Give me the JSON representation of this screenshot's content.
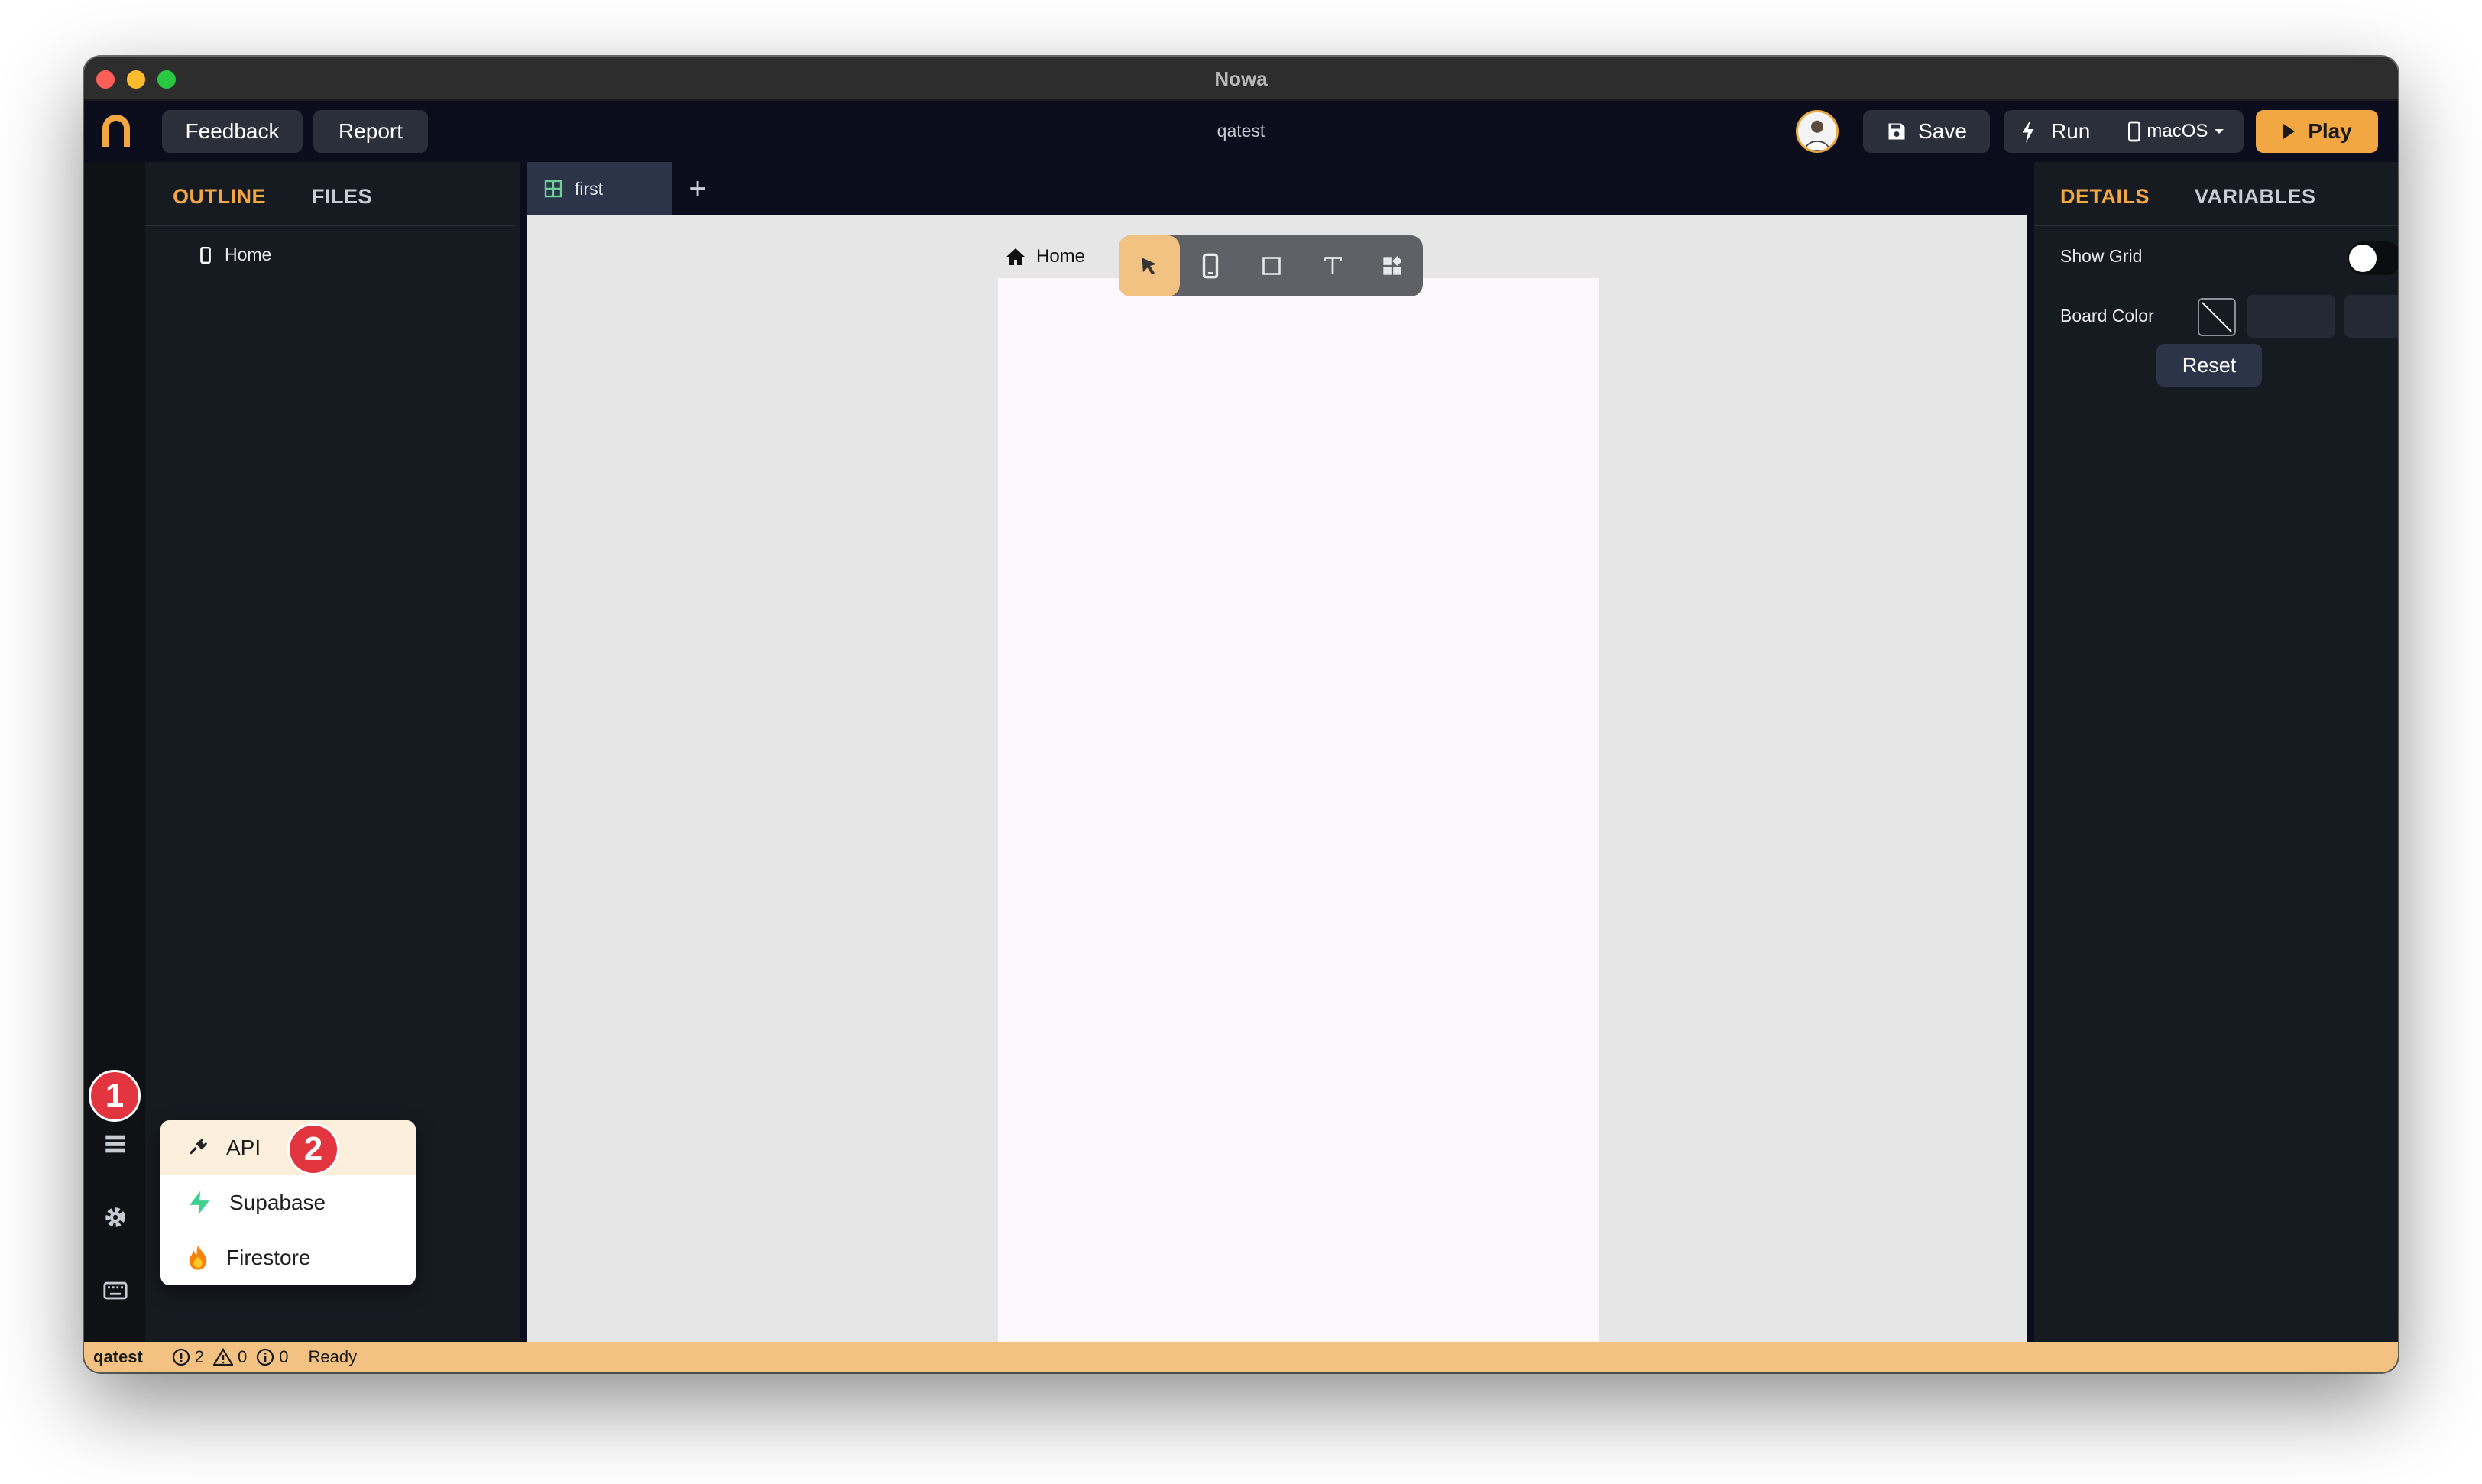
{
  "window": {
    "title": "Nowa"
  },
  "topbar": {
    "feedback_label": "Feedback",
    "report_label": "Report",
    "project_name": "qatest",
    "save_label": "Save",
    "run_label": "Run",
    "platform_label": "macOS",
    "play_label": "Play"
  },
  "left_panel": {
    "tabs": [
      {
        "label": "OUTLINE",
        "active": true
      },
      {
        "label": "FILES",
        "active": false
      }
    ],
    "outline_items": [
      {
        "label": "Home",
        "icon": "phone-icon"
      }
    ]
  },
  "editor": {
    "file_tabs": [
      {
        "label": "first",
        "icon": "grid-icon"
      }
    ],
    "add_tab_label": "+",
    "board_label": "Home",
    "toolbar_tools": [
      "select-tool",
      "device-tool",
      "container-tool",
      "text-tool",
      "widgets-tool"
    ]
  },
  "right_panel": {
    "tabs": [
      {
        "label": "DETAILS",
        "active": true
      },
      {
        "label": "VARIABLES",
        "active": false
      }
    ],
    "show_grid_label": "Show Grid",
    "show_grid_on": false,
    "board_color_label": "Board Color",
    "reset_label": "Reset"
  },
  "popup_menu": {
    "items": [
      {
        "label": "API",
        "icon": "plug-icon",
        "highlighted": true
      },
      {
        "label": "Supabase",
        "icon": "supabase-icon",
        "highlighted": false
      },
      {
        "label": "Firestore",
        "icon": "firebase-icon",
        "highlighted": false
      }
    ]
  },
  "annotations": {
    "step1": "1",
    "step2": "2"
  },
  "statusbar": {
    "project": "qatest",
    "errors": "2",
    "warnings": "0",
    "infos": "0",
    "status": "Ready"
  },
  "colors": {
    "accent": "#f3a743",
    "statusbar": "#f3c282",
    "badge": "#e3353f",
    "topbar": "#0c0d1c",
    "panel": "#161b22"
  }
}
